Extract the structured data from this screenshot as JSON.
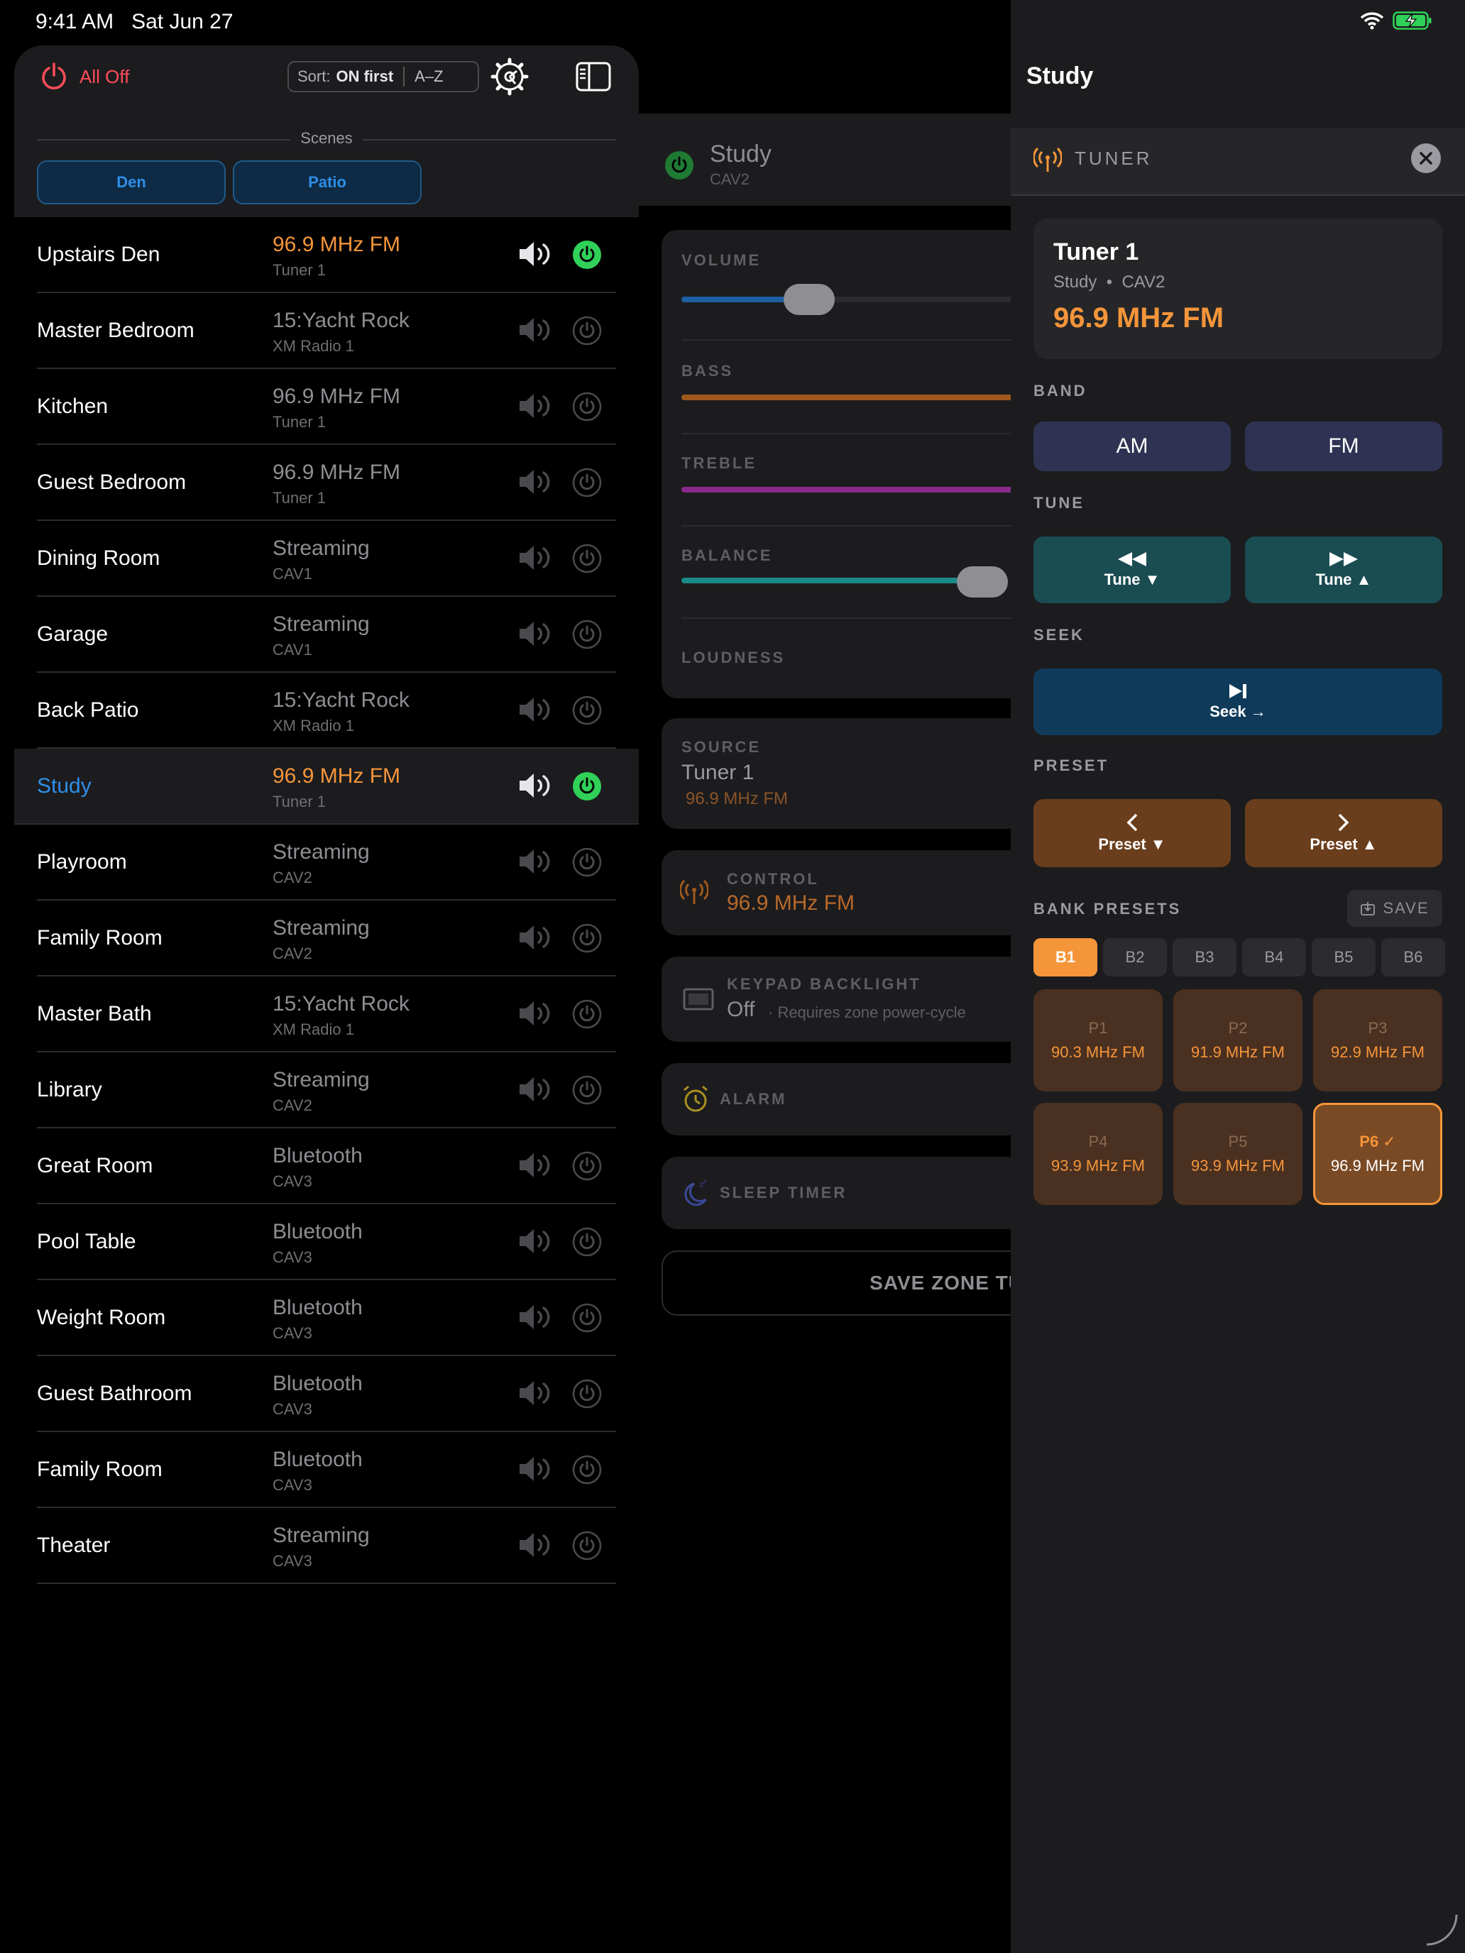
{
  "status": {
    "time": "9:41 AM",
    "date": "Sat Jun 27"
  },
  "header": {
    "all_off": "All Off",
    "sort_label": "Sort:",
    "sort_on_first": "ON first",
    "sort_az": "A–Z"
  },
  "scenes": {
    "label": "Scenes",
    "items": [
      "Den",
      "Patio"
    ]
  },
  "zones": [
    {
      "name": "Upstairs Den",
      "source": "96.9 MHz FM",
      "sub": "Tuner 1",
      "on": true
    },
    {
      "name": "Master Bedroom",
      "source": "15:Yacht Rock",
      "sub": "XM Radio 1",
      "on": false
    },
    {
      "name": "Kitchen",
      "source": "96.9 MHz FM",
      "sub": "Tuner 1",
      "on": false
    },
    {
      "name": "Guest Bedroom",
      "source": "96.9 MHz FM",
      "sub": "Tuner 1",
      "on": false
    },
    {
      "name": "Dining Room",
      "source": "Streaming",
      "sub": "CAV1",
      "on": false
    },
    {
      "name": "Garage",
      "source": "Streaming",
      "sub": "CAV1",
      "on": false
    },
    {
      "name": "Back Patio",
      "source": "15:Yacht Rock",
      "sub": "XM Radio 1",
      "on": false
    },
    {
      "name": "Study",
      "source": "96.9 MHz FM",
      "sub": "Tuner 1",
      "on": true,
      "selected": true
    },
    {
      "name": "Playroom",
      "source": "Streaming",
      "sub": "CAV2",
      "on": false
    },
    {
      "name": "Family Room",
      "source": "Streaming",
      "sub": "CAV2",
      "on": false
    },
    {
      "name": "Master Bath",
      "source": "15:Yacht Rock",
      "sub": "XM Radio 1",
      "on": false
    },
    {
      "name": "Library",
      "source": "Streaming",
      "sub": "CAV2",
      "on": false
    },
    {
      "name": "Great Room",
      "source": "Bluetooth",
      "sub": "CAV3",
      "on": false
    },
    {
      "name": "Pool Table",
      "source": "Bluetooth",
      "sub": "CAV3",
      "on": false
    },
    {
      "name": "Weight Room",
      "source": "Bluetooth",
      "sub": "CAV3",
      "on": false
    },
    {
      "name": "Guest Bathroom",
      "source": "Bluetooth",
      "sub": "CAV3",
      "on": false
    },
    {
      "name": "Family Room",
      "source": "Bluetooth",
      "sub": "CAV3",
      "on": false
    },
    {
      "name": "Theater",
      "source": "Streaming",
      "sub": "CAV3",
      "on": false
    }
  ],
  "zone_detail": {
    "name": "Study",
    "sub": "CAV2",
    "volume_label": "VOLUME",
    "volume_level": 0.35,
    "bass_label": "BASS",
    "treble_label": "TREBLE",
    "balance_label": "BALANCE",
    "loudness_label": "LOUDNESS",
    "source_label": "SOURCE",
    "source_name": "Tuner 1",
    "source_freq": "96.9 MHz FM",
    "control_label": "CONTROL",
    "control_value": "96.9 MHz FM",
    "backlight_label": "KEYPAD BACKLIGHT",
    "backlight_value": "Off",
    "backlight_note": "· Requires zone power-cycle",
    "alarm_label": "ALARM",
    "sleep_label": "SLEEP TIMER",
    "save_label": "SAVE ZONE TU"
  },
  "tuner": {
    "title": "Study",
    "section_label": "TUNER",
    "name": "Tuner 1",
    "zone": "Study",
    "dot": "•",
    "cav": "CAV2",
    "frequency": "96.9 MHz FM",
    "band_label": "BAND",
    "band_am": "AM",
    "band_fm": "FM",
    "tune_label": "TUNE",
    "tune_down": "Tune ▼",
    "tune_up": "Tune ▲",
    "seek_label": "SEEK",
    "seek": "Seek →",
    "preset_label": "PRESET",
    "preset_down": "Preset ▼",
    "preset_up": "Preset ▲",
    "bank_label": "BANK PRESETS",
    "save": "SAVE",
    "banks": [
      "B1",
      "B2",
      "B3",
      "B4",
      "B5",
      "B6"
    ],
    "presets": [
      {
        "label": "P1",
        "freq": "90.3 MHz FM"
      },
      {
        "label": "P2",
        "freq": "91.9 MHz FM"
      },
      {
        "label": "P3",
        "freq": "92.9 MHz FM"
      },
      {
        "label": "P4",
        "freq": "93.9 MHz FM"
      },
      {
        "label": "P5",
        "freq": "93.9 MHz FM"
      },
      {
        "label": "P6 ✓",
        "freq": "96.9 MHz FM"
      }
    ]
  },
  "colors": {
    "accent": "#f5953a",
    "blue": "#2e8fe8",
    "green": "#30d158",
    "red": "#ff4d5a"
  }
}
